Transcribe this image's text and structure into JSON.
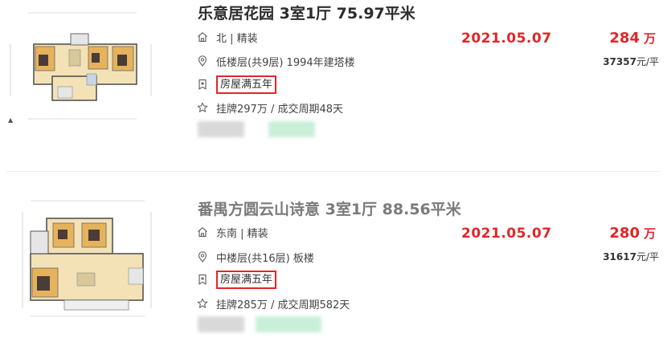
{
  "listings": [
    {
      "title": "乐意居花园 3室1厅 75.97平米",
      "house_info": "北 | 精装",
      "floor_info": "低楼层(共9层) 1994年建塔楼",
      "tag": "房屋满五年",
      "listing_info": "挂牌297万 / 成交周期48天",
      "deal_date": "2021.05.07",
      "total_price": "284",
      "total_price_unit": "万",
      "unit_price": "37357",
      "unit_price_unit": "元/平"
    },
    {
      "title": "番禺方圆云山诗意 3室1厅 88.56平米",
      "house_info": "东南 | 精装",
      "floor_info": "中楼层(共16层) 板楼",
      "tag": "房屋满五年",
      "listing_info": "挂牌285万 / 成交周期582天",
      "deal_date": "2021.05.07",
      "total_price": "280",
      "total_price_unit": "万",
      "unit_price": "31617",
      "unit_price_unit": "元/平"
    }
  ],
  "icons": {
    "house": "house-icon",
    "location": "location-pin-icon",
    "tag": "shield-tag-icon",
    "star": "star-icon"
  },
  "colors": {
    "accent_red": "#e0262a",
    "text": "#333333",
    "title_dark": "#2c2c2c",
    "title_gray": "#7a7a7a",
    "icon_gray": "#666666"
  }
}
